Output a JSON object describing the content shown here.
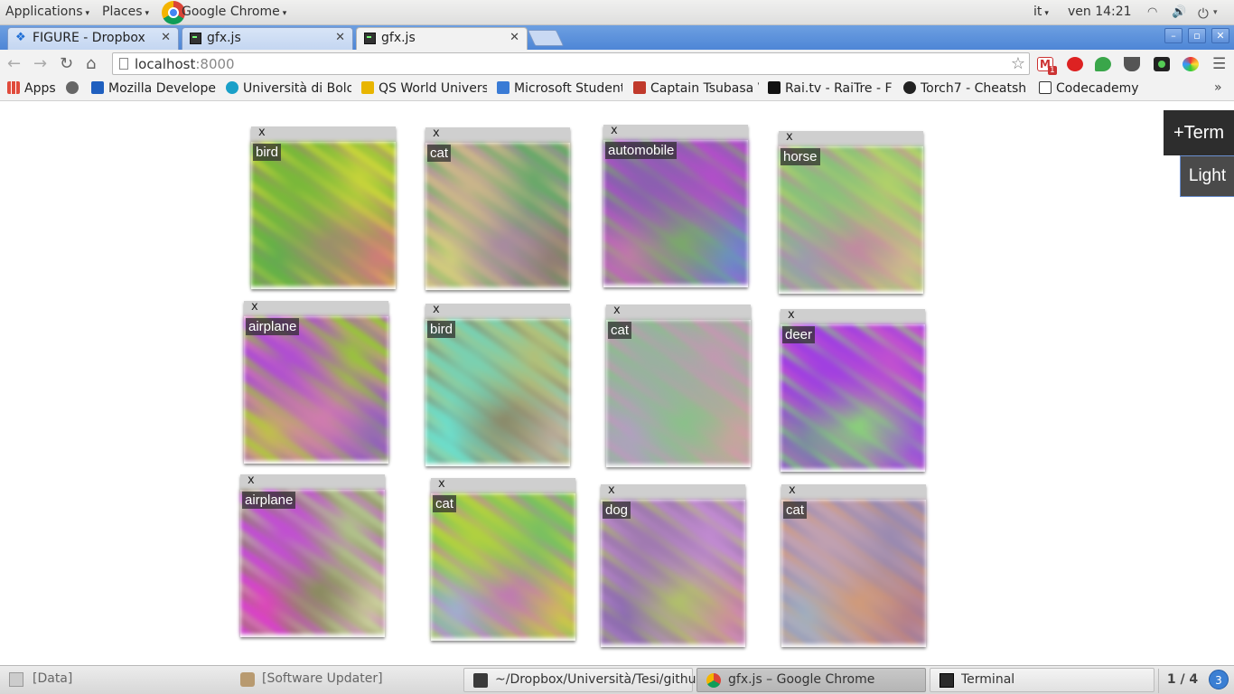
{
  "top_panel": {
    "applications": "Applications",
    "places": "Places",
    "active_app": "Google Chrome",
    "language": "it",
    "clock": "ven 14:21"
  },
  "browser": {
    "tabs": [
      {
        "title": "FIGURE - Dropbox",
        "icon": "dropbox-icon"
      },
      {
        "title": "gfx.js",
        "icon": "terminal-icon"
      },
      {
        "title": "gfx.js",
        "icon": "terminal-icon"
      }
    ],
    "url_host": "localhost",
    "url_port": ":8000",
    "bookmarks": [
      {
        "label": "Apps",
        "color": "#e04b3c"
      },
      {
        "label": "",
        "color": "#666666"
      },
      {
        "label": "Mozilla Developer",
        "color": "#1f5fbf"
      },
      {
        "label": "Università di Bolo",
        "color": "#1aa0c8"
      },
      {
        "label": "QS World Univers",
        "color": "#e8b500"
      },
      {
        "label": "Microsoft Student",
        "color": "#3a7bd5"
      },
      {
        "label": "Captain Tsubasa V",
        "color": "#c0392b"
      },
      {
        "label": "Rai.tv - RaiTre - F",
        "color": "#111111"
      },
      {
        "label": "Torch7 - Cheatsh",
        "color": "#222222"
      },
      {
        "label": "Codecademy",
        "color": "#333333"
      }
    ],
    "bookmarks_more": "»",
    "gmail_badge": "1"
  },
  "page": {
    "term_button": "+Term",
    "light_button": "Light",
    "close_glyph": "x",
    "panels": [
      {
        "label": "bird",
        "palette": [
          "#7ab83a",
          "#c5d33a",
          "#9b8f6a",
          "#5fae4c",
          "#d97a7a"
        ]
      },
      {
        "label": "cat",
        "palette": [
          "#c9b48a",
          "#6aa86a",
          "#a88aa0",
          "#d2d07a",
          "#8a7a6a"
        ]
      },
      {
        "label": "automobile",
        "palette": [
          "#8b5fb0",
          "#b04fc8",
          "#7aa86a",
          "#c07aa8",
          "#6a8ad0"
        ]
      },
      {
        "label": "horse",
        "palette": [
          "#8ac07a",
          "#b0d06a",
          "#c08aa0",
          "#9a9ab0",
          "#d0c08a"
        ]
      },
      {
        "label": "airplane",
        "palette": [
          "#b04fd0",
          "#9ac040",
          "#d07ab0",
          "#c0c04a",
          "#8a6ab0"
        ]
      },
      {
        "label": "bird",
        "palette": [
          "#7ad0b0",
          "#b0c07a",
          "#8a8a6a",
          "#6ae0d0",
          "#c0b0a0"
        ]
      },
      {
        "label": "cat",
        "palette": [
          "#9ab0a0",
          "#c09ab0",
          "#8ac08a",
          "#b0a0c0",
          "#d0a0a0"
        ]
      },
      {
        "label": "deer",
        "palette": [
          "#a040e0",
          "#c050d0",
          "#8ad07a",
          "#7a8aa0",
          "#9a60d0"
        ]
      },
      {
        "label": "airplane",
        "palette": [
          "#c050d0",
          "#b0c08a",
          "#8a8a60",
          "#e040c0",
          "#d0d0a0"
        ]
      },
      {
        "label": "cat",
        "palette": [
          "#b0d040",
          "#7ac060",
          "#c07ab0",
          "#a0b0d0",
          "#d0c050"
        ]
      },
      {
        "label": "dog",
        "palette": [
          "#a07ab0",
          "#c08ad0",
          "#b0c06a",
          "#8a6ab0",
          "#d08aa0"
        ]
      },
      {
        "label": "cat",
        "palette": [
          "#c0a0b0",
          "#9a8ab0",
          "#d09a7a",
          "#a0b0c0",
          "#b07a8a"
        ]
      }
    ]
  },
  "taskbar": {
    "items": [
      {
        "label": "[Data]",
        "color": "#8a8a8a"
      },
      {
        "label": "[Software Updater]",
        "color": "#9a7a5a"
      },
      {
        "label": "~/Dropbox/Università/Tesi/githu...",
        "color": "#3a3a3a"
      },
      {
        "label": "gfx.js – Google Chrome",
        "color": "#db4437"
      },
      {
        "label": "Terminal",
        "color": "#2a2a2a"
      }
    ],
    "workspace": "1 / 4",
    "notifications": "3"
  }
}
